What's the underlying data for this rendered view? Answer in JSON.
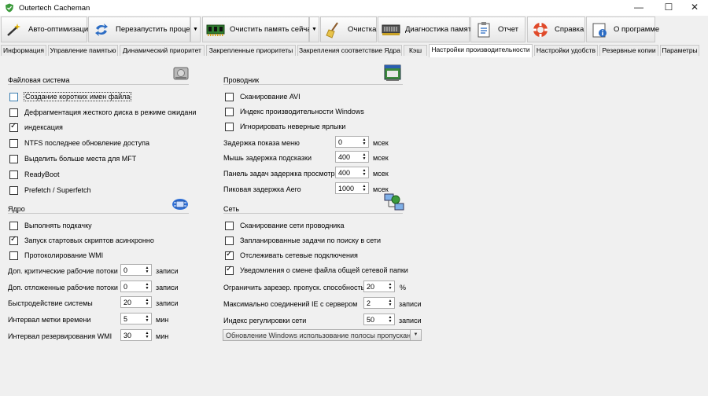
{
  "window": {
    "title": "Outertech Cacheman",
    "minimize": "—",
    "maximize": "☐",
    "close": "✕"
  },
  "toolbar": {
    "auto_optimize": "Авто-оптимизация",
    "restart_process": "Перезапустить процесс",
    "clear_memory": "Очистить память сейчас!",
    "cleanup": "Очистка",
    "memory_diagnostics": "Диагностика памяти",
    "report": "Отчет",
    "help": "Справка",
    "about": "О программе"
  },
  "tabs": [
    "Информация",
    "Управление памятью",
    "Динамический приоритет",
    "Закрепленные приоритеты",
    "Закрепления соответствие Ядра",
    "Кэш",
    "Настройки производительности",
    "Настройки удобств",
    "Резервные копии",
    "Параметры"
  ],
  "active_tab": "Настройки производительности",
  "filesystem": {
    "title": "Файловая система",
    "items": [
      {
        "label": "Создание коротких имен файла",
        "checked": false
      },
      {
        "label": "Дефрагментация жесткого диска в режиме ожидани",
        "checked": false
      },
      {
        "label": "индексация",
        "checked": true
      },
      {
        "label": "NTFS последнее обновление доступа",
        "checked": false
      },
      {
        "label": "Выделить больше места для MFT",
        "checked": false
      },
      {
        "label": "ReadyBoot",
        "checked": false
      },
      {
        "label": "Prefetch / Superfetch",
        "checked": false
      }
    ]
  },
  "kernel": {
    "title": "Ядро",
    "items": [
      {
        "label": "Выполнять подкачку",
        "checked": false
      },
      {
        "label": "Запуск стартовых скриптов асинхронно",
        "checked": true
      },
      {
        "label": "Протоколирование WMI",
        "checked": false
      }
    ],
    "fields": [
      {
        "label": "Доп. критические рабочие потоки",
        "value": "0",
        "unit": "записи"
      },
      {
        "label": "Доп. отложенные рабочие потоки",
        "value": "0",
        "unit": "записи"
      },
      {
        "label": "Быстродействие системы",
        "value": "20",
        "unit": "записи"
      },
      {
        "label": "Интервал метки времени",
        "value": "5",
        "unit": "мин"
      },
      {
        "label": "Интервал резервирования WMI",
        "value": "30",
        "unit": "мин"
      }
    ]
  },
  "explorer": {
    "title": "Проводник",
    "items": [
      {
        "label": "Сканирование AVI",
        "checked": false
      },
      {
        "label": "Индекс производительности Windows",
        "checked": false
      },
      {
        "label": "Игнорировать неверные ярлыки",
        "checked": false
      }
    ],
    "fields": [
      {
        "label": "Задержка показа меню",
        "value": "0",
        "unit": "мсек"
      },
      {
        "label": "Мышь задержка подсказки",
        "value": "400",
        "unit": "мсек"
      },
      {
        "label": "Панель задач задержка просмотра",
        "value": "400",
        "unit": "мсек"
      },
      {
        "label": "Пиковая задержка Aero",
        "value": "1000",
        "unit": "мсек"
      }
    ]
  },
  "network": {
    "title": "Сеть",
    "items": [
      {
        "label": "Сканирование сети проводника",
        "checked": false
      },
      {
        "label": "Запланированные задачи по поиску в сети",
        "checked": false
      },
      {
        "label": "Отслеживать сетевые подключения",
        "checked": true
      },
      {
        "label": "Уведомления о смене файла общей сетевой папки",
        "checked": true
      }
    ],
    "fields": [
      {
        "label": "Ограничить зарезер. пропуск. способность",
        "value": "20",
        "unit": "%"
      },
      {
        "label": "Максимально соединений IE с сервером",
        "value": "2",
        "unit": "записи"
      },
      {
        "label": "Индекс регулировки сети",
        "value": "50",
        "unit": "записи"
      }
    ],
    "dropdown": "Обновление Windows использование полосы пропускания"
  },
  "icons": {
    "app": "shield-check-icon",
    "auto_optimize": "wand-icon",
    "restart_process": "restart-arrows-icon",
    "clear_memory": "memory-chip-icon",
    "cleanup": "broom-icon",
    "memory_diagnostics": "ram-stick-icon",
    "report": "report-clipboard-icon",
    "help": "lifebuoy-icon",
    "about": "about-note-icon",
    "filesystem": "hard-drive-icon",
    "kernel": "kernel-chip-icon",
    "explorer": "explorer-window-icon",
    "network": "network-computers-icon"
  },
  "colors": {
    "active_tab_bg": "#ffffff",
    "window_bg": "#f0f0f0",
    "focus_checkbox": "#3c7fb1",
    "shield_green": "#3c9a3c"
  }
}
